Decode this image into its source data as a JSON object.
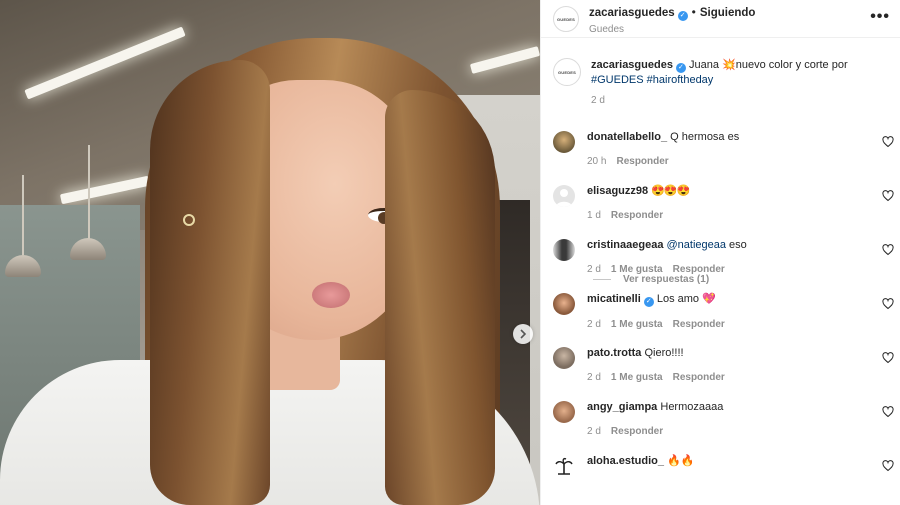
{
  "post": {
    "author": "zacariasguedes",
    "follow_status": "Siguiendo",
    "author_subname": "Guedes",
    "avatar_text": "GUEDES",
    "separator": "•",
    "more_label": "•••"
  },
  "caption": {
    "username": "zacariasguedes",
    "text_before": "Juana ",
    "emoji": "💥",
    "text_after": "nuevo color y corte por ",
    "hashtag1": "#GUEDES",
    "hashtag2": "#hairoftheday",
    "time": "2 d"
  },
  "comments": [
    {
      "user": "donatellabello_",
      "text": "Q hermosa es",
      "time": "20 h",
      "likes": "",
      "reply": "Responder",
      "avatar_color": "#6b5a3a"
    },
    {
      "user": "elisaguzz98",
      "text": "😍😍😍",
      "time": "1 d",
      "likes": "",
      "reply": "Responder",
      "avatar_color": "#e4e4e4"
    },
    {
      "user": "cristinaaegeaa",
      "mention": "@natiegeaa",
      "text": " eso",
      "time": "2 d",
      "likes": "1 Me gusta",
      "reply": "Responder",
      "avatar_color": "#3a3a3a"
    },
    {
      "user": "micatinelli",
      "text": "Los amo ",
      "emoji": "💖",
      "time": "2 d",
      "likes": "1 Me gusta",
      "reply": "Responder",
      "avatar_color": "#8a5a3c"
    },
    {
      "user": "pato.trotta",
      "text": "Qiero!!!!",
      "time": "2 d",
      "likes": "1 Me gusta",
      "reply": "Responder",
      "avatar_color": "#7c6d60"
    },
    {
      "user": "angy_giampa",
      "text": "Hermozaaaa",
      "time": "2 d",
      "likes": "",
      "reply": "Responder",
      "avatar_color": "#9a6a4c"
    },
    {
      "user": "aloha.estudio_",
      "emoji": "🔥🔥",
      "avatar_color": "#ffffff"
    }
  ],
  "view_replies": "Ver respuestas (1)",
  "icons": {
    "verified": "verified-badge-icon",
    "heart": "heart-outline-icon",
    "next": "chevron-right-icon",
    "more": "more-options-icon"
  },
  "colors": {
    "verified": "#3897f0",
    "link": "#00376b",
    "muted": "#8e8e8e"
  }
}
